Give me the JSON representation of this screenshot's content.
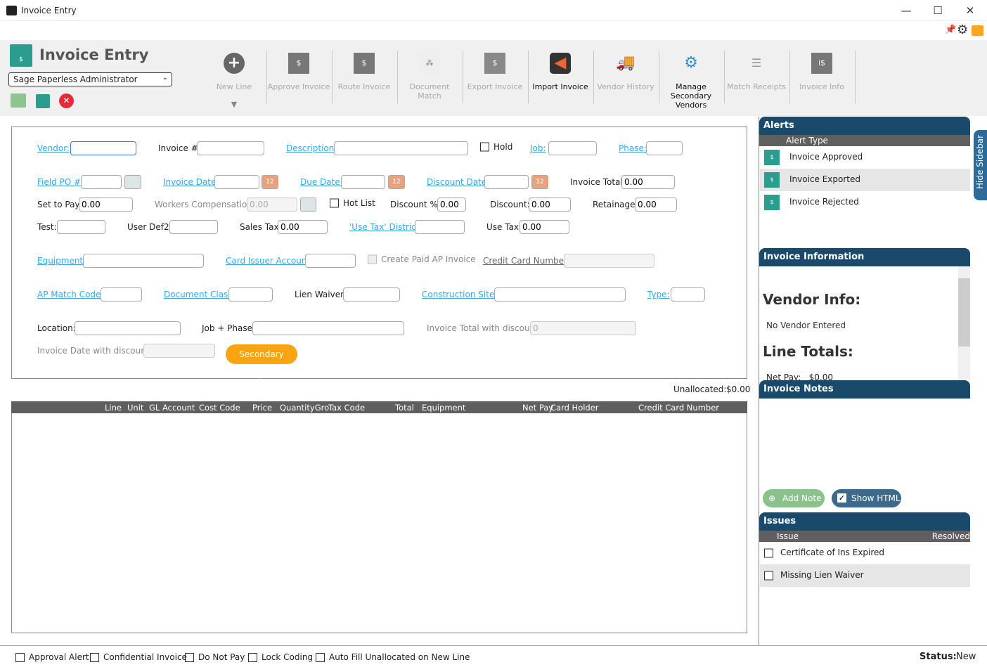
{
  "window": {
    "title": "Invoice Entry",
    "minimize": "—",
    "maximize": "☐",
    "close": "✕"
  },
  "header": {
    "title": "Invoice Entry",
    "user": "Sage Paperless Administrator"
  },
  "toolbar": [
    {
      "label": "New Line",
      "icon": "plus-circle-icon",
      "enabled": false
    },
    {
      "label": "Approve Invoice",
      "icon": "approve-invoice-icon",
      "enabled": false
    },
    {
      "label": "Route Invoice",
      "icon": "route-invoice-icon",
      "enabled": false
    },
    {
      "label": "Document Match",
      "icon": "document-match-icon",
      "enabled": false
    },
    {
      "label": "Export Invoice",
      "icon": "export-invoice-icon",
      "enabled": false
    },
    {
      "label": "Import Invoice",
      "icon": "import-invoice-icon",
      "enabled": true
    },
    {
      "label": "Vendor History",
      "icon": "vendor-history-icon",
      "enabled": false
    },
    {
      "label": "Manage Secondary Vendors",
      "icon": "manage-vendors-icon",
      "enabled": true
    },
    {
      "label": "Match Receipts",
      "icon": "match-receipts-icon",
      "enabled": false
    },
    {
      "label": "Invoice Info",
      "icon": "invoice-info-icon",
      "enabled": false
    }
  ],
  "form": {
    "vendor": "Vendor:",
    "invoice_no": "Invoice #:",
    "description": "Description:",
    "hold": "Hold",
    "job": "Job:",
    "phase": "Phase:",
    "field_po": "Field PO #:",
    "invoice_date": "Invoice Date:",
    "due_date": "Due Date:",
    "discount_date": "Discount Date:",
    "invoice_total": "Invoice Total:",
    "invoice_total_val": "0.00",
    "set_to_pay": "Set to Pay:",
    "set_to_pay_val": "0.00",
    "workers_comp": "Workers Compensation:",
    "workers_comp_val": "0.00",
    "hot_list": "Hot List",
    "discount_pct": "Discount %:",
    "discount_pct_val": "0.00",
    "discount": "Discount:",
    "discount_val": "0.00",
    "retainage": "Retainage:",
    "retainage_val": "0.00",
    "test": "Test:",
    "user_def2": "User Def2:",
    "sales_tax": "Sales Tax:",
    "sales_tax_val": "0.00",
    "use_tax_district": "'Use Tax' District:",
    "use_tax": "Use Tax:",
    "use_tax_val": "0.00",
    "equipment": "Equipment:",
    "card_issuer": "Card Issuer Account:",
    "create_paid": "Create Paid AP Invoice",
    "credit_card": "Credit Card Number:",
    "ap_match": "AP Match Code:",
    "document_class": "Document Class:",
    "lien_waiver": "Lien Waiver:",
    "construction_sites": "Construction Sites:",
    "type": "Type:",
    "location": "Location:",
    "job_phase": "Job + Phase:",
    "total_with_discount": "Invoice Total with discount:",
    "total_with_discount_val": "0",
    "date_with_discount": "Invoice Date with discount :",
    "secondary_payee": "Secondary Payee",
    "calendar_text": "12"
  },
  "grid": {
    "unallocated_label": "Unallocated:",
    "unallocated_val": "$0.00",
    "columns": [
      "Line",
      "Unit",
      "GL Account",
      "Cost Code",
      "Price",
      "QuantityGro",
      "Tax Code",
      "Total",
      "Equipment",
      "Net Pay",
      "Card Holder",
      "Credit Card Number"
    ]
  },
  "sidebar": {
    "hide": "Hide Sidebar",
    "alerts": {
      "title": "Alerts",
      "column": "Alert Type",
      "items": [
        "Invoice Approved",
        "Invoice Exported",
        "Invoice Rejected"
      ]
    },
    "info": {
      "title": "Invoice Information",
      "vendor_heading": "Vendor Info:",
      "vendor_text": "No Vendor Entered",
      "totals_heading": "Line Totals:",
      "net_pay": "Net Pay:   $0.00"
    },
    "notes": {
      "title": "Invoice Notes",
      "add": "Add Note",
      "show_html": "Show HTML"
    },
    "issues": {
      "title": "Issues",
      "col_issue": "Issue",
      "col_resolved": "Resolved",
      "items": [
        "Certificate of Ins Expired",
        "Missing Lien Waiver"
      ]
    }
  },
  "footer": {
    "checks": [
      "Approval Alert",
      "Confidential Invoice",
      "Do Not Pay",
      "Lock Coding",
      "Auto Fill Unallocated on New Line"
    ],
    "status_label": "Status:",
    "status_val": "New"
  },
  "colors": {
    "link": "#3aa7e6",
    "header": "#1a4a6b",
    "accent": "#fca311",
    "grid_header": "#5f5f5f"
  }
}
